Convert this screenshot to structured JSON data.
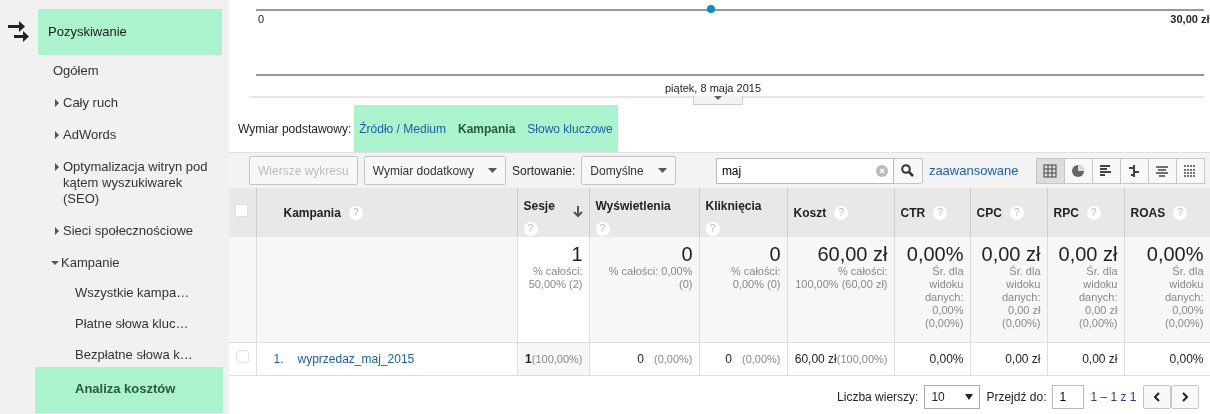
{
  "sidebar": {
    "section": {
      "label": "Pozyskiwanie",
      "highlighted": true
    },
    "items": [
      {
        "label": "Ogółem",
        "expandable": false,
        "selected": false,
        "highlighted": false
      },
      {
        "label": "Cały ruch",
        "expandable": true,
        "expanded": false,
        "selected": false,
        "highlighted": false
      },
      {
        "label": "AdWords",
        "expandable": true,
        "expanded": false,
        "selected": false,
        "highlighted": false
      },
      {
        "label": "Optymalizacja witryn pod kątem wyszukiwarek (SEO)",
        "expandable": true,
        "expanded": false,
        "selected": false,
        "highlighted": false
      },
      {
        "label": "Sieci społecznościowe",
        "expandable": true,
        "expanded": false,
        "selected": false,
        "highlighted": false
      },
      {
        "label": "Kampanie",
        "expandable": true,
        "expanded": true,
        "selected": false,
        "highlighted": false,
        "children": [
          {
            "label": "Wszystkie kampa…",
            "selected": false,
            "highlighted": false
          },
          {
            "label": "Płatne słowa kluc…",
            "selected": false,
            "highlighted": false
          },
          {
            "label": "Bezpłatne słowa k…",
            "selected": false,
            "highlighted": false
          },
          {
            "label": "Analiza kosztów",
            "selected": true,
            "highlighted": true
          }
        ]
      }
    ]
  },
  "chart": {
    "y_start_label": "0",
    "y_end_label": "30,00 zł",
    "x_label": "piątek, 8 maja 2015"
  },
  "dimension": {
    "label": "Wymiar podstawowy:",
    "highlighted": true,
    "options": [
      {
        "label": "Źródło / Medium",
        "selected": false
      },
      {
        "label": "Kampania",
        "selected": true
      },
      {
        "label": "Słowo kluczowe",
        "selected": false
      }
    ]
  },
  "toolbar": {
    "plot_rows": {
      "label": "Wiersze wykresu",
      "disabled": true
    },
    "secondary_dimension": "Wymiar dodatkowy",
    "sort_label": "Sortowanie:",
    "sort_value": "Domyślne",
    "search_value": "maj",
    "advanced": "zaawansowane",
    "views": [
      {
        "kind": "table",
        "selected": true
      },
      {
        "kind": "pie",
        "selected": false
      },
      {
        "kind": "performance",
        "selected": false
      },
      {
        "kind": "comparison",
        "selected": false
      },
      {
        "kind": "terms",
        "selected": false
      },
      {
        "kind": "pivot",
        "selected": false
      }
    ]
  },
  "table": {
    "select_all_checked": false,
    "columns": [
      {
        "label": "Kampania",
        "help": "?",
        "sorted": false
      },
      {
        "label": "Sesje",
        "help": "?",
        "sorted": true
      },
      {
        "label": "Wyświetlenia",
        "help": "?",
        "sorted": false
      },
      {
        "label": "Kliknięcia",
        "help": "?",
        "sorted": false
      },
      {
        "label": "Koszt",
        "help": "?",
        "sorted": false
      },
      {
        "label": "CTR",
        "help": "?",
        "sorted": false
      },
      {
        "label": "CPC",
        "help": "?",
        "sorted": false
      },
      {
        "label": "RPC",
        "help": "?",
        "sorted": false
      },
      {
        "label": "ROAS",
        "help": "?",
        "sorted": false
      }
    ],
    "totals": [
      {
        "value": "1",
        "note": "% całości: 50,00% (2)"
      },
      {
        "value": "0",
        "note": "% całości: 0,00% (0)"
      },
      {
        "value": "0",
        "note": "% całości: 0,00% (0)"
      },
      {
        "value": "60,00 zł",
        "note": "% całości: 100,00% (60,00 zł)"
      },
      {
        "value": "0,00%",
        "note": "Śr. dla widoku danych: 0,00% (0,00%)"
      },
      {
        "value": "0,00 zł",
        "note": "Śr. dla widoku danych: 0,00 zł (0,00%)"
      },
      {
        "value": "0,00 zł",
        "note": "Śr. dla widoku danych: 0,00 zł (0,00%)"
      },
      {
        "value": "0,00%",
        "note": "Śr. dla widoku danych: 0,00% (0,00%)"
      }
    ],
    "rows": [
      {
        "index": "1.",
        "checked": false,
        "cells": [
          {
            "value": "wyprzedaz_maj_2015"
          },
          {
            "value": "1",
            "share": "(100,00%)"
          },
          {
            "value": "0",
            "share": "(0,00%)"
          },
          {
            "value": "0",
            "share": "(0,00%)"
          },
          {
            "value": "60,00 zł",
            "share": "(100,00%)"
          },
          {
            "value": "0,00%"
          },
          {
            "value": "0,00 zł"
          },
          {
            "value": "0,00 zł"
          },
          {
            "value": "0,00%"
          }
        ]
      }
    ]
  },
  "pagination": {
    "rows_label": "Liczba wierszy:",
    "rows_value": "10",
    "goto_label": "Przejdź do:",
    "goto_value": "1",
    "range": "1 – 1 z 1"
  }
}
